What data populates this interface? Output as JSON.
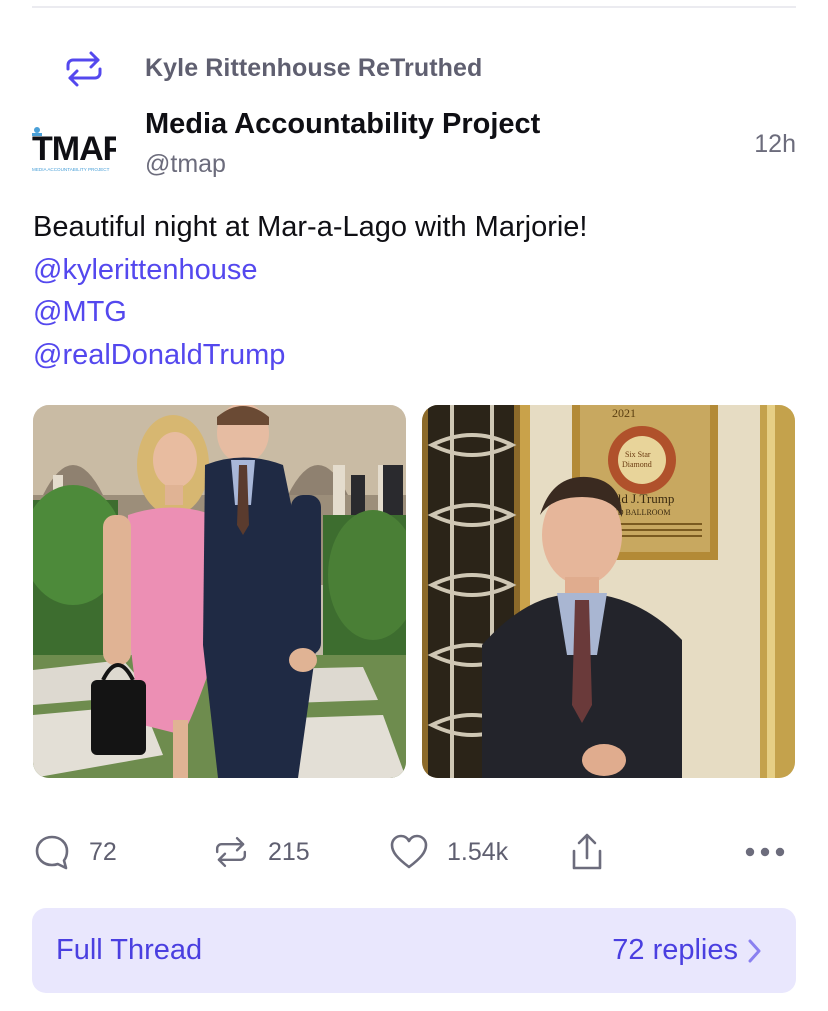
{
  "retruth": {
    "label": "Kyle Rittenhouse ReTruthed",
    "icon": "retruth-icon"
  },
  "post": {
    "author": {
      "name": "Media Accountability Project",
      "handle": "@tmap",
      "avatar_text": "TMAP",
      "avatar_subtext": "MEDIA ACCOUNTABILITY PROJECT"
    },
    "timestamp": "12h",
    "text": "Beautiful night at Mar-a-Lago with Marjorie!",
    "mentions": [
      "@kylerittenhouse",
      "@MTG",
      "@realDonaldTrump"
    ],
    "media": [
      {
        "name": "photo-woman-pink-dress-and-man-in-suit",
        "description_visible": false
      },
      {
        "name": "photo-man-in-suit-near-plaque",
        "plaque": {
          "year": "2021",
          "name": "ald J.Trump",
          "room": "ND BALLROOM",
          "seal": "Six Star Diamond Award"
        }
      }
    ]
  },
  "actions": {
    "reply": {
      "icon": "reply-bubble-icon",
      "count": "72"
    },
    "retruth": {
      "icon": "retruth-icon",
      "count": "215"
    },
    "like": {
      "icon": "heart-icon",
      "count": "1.54k"
    },
    "share": {
      "icon": "share-icon"
    },
    "more": {
      "icon": "more-dots-icon"
    }
  },
  "thread": {
    "label": "Full Thread",
    "replies": "72 replies"
  },
  "colors": {
    "accent": "#5448ee",
    "thread_bg": "#e9e7fd",
    "muted": "#6c6c7c"
  }
}
